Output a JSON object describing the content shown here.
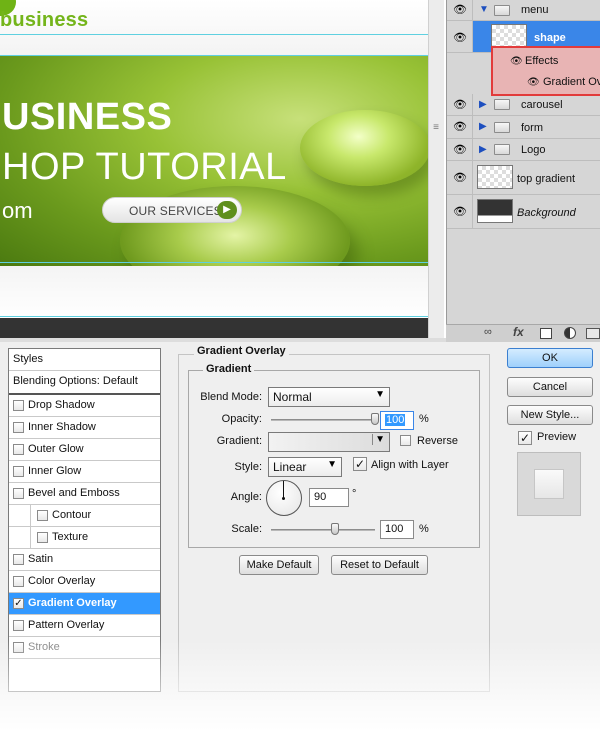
{
  "canvas": {
    "logo_text": "business",
    "hero_title": "USINESS",
    "hero_subtitle": "HOP TUTORIAL",
    "hero_url": "om",
    "cta_label": "OUR SERVICES",
    "cta_icon": "play-arrow-icon"
  },
  "layers": {
    "rows": [
      {
        "name": "menu",
        "type": "group",
        "expanded": true
      },
      {
        "name": "shape",
        "type": "layer",
        "selected": true
      },
      {
        "name": "Effects",
        "type": "effects"
      },
      {
        "name": "Gradient Ov",
        "type": "effect"
      },
      {
        "name": "carousel",
        "type": "group"
      },
      {
        "name": "form",
        "type": "group"
      },
      {
        "name": "Logo",
        "type": "group"
      },
      {
        "name": "top gradient",
        "type": "layer"
      },
      {
        "name": "Background",
        "type": "layer"
      }
    ],
    "toolbar_icons": [
      "link-icon",
      "fx-icon",
      "mask-icon",
      "adjustment-icon",
      "folder-icon"
    ],
    "fx_label": "fx",
    "highlight_color": "#e23b3b",
    "selection_color": "#3a86e8"
  },
  "dialog": {
    "styles_header": "Styles",
    "blending_options": "Blending Options: Default",
    "style_items": [
      {
        "label": "Drop Shadow",
        "checked": false
      },
      {
        "label": "Inner Shadow",
        "checked": false
      },
      {
        "label": "Outer Glow",
        "checked": false
      },
      {
        "label": "Inner Glow",
        "checked": false
      },
      {
        "label": "Bevel and Emboss",
        "checked": false
      },
      {
        "label": "Contour",
        "checked": false
      },
      {
        "label": "Texture",
        "checked": false
      },
      {
        "label": "Satin",
        "checked": false
      },
      {
        "label": "Color Overlay",
        "checked": false
      },
      {
        "label": "Gradient Overlay",
        "checked": true,
        "active": true
      },
      {
        "label": "Pattern Overlay",
        "checked": false
      },
      {
        "label": "Stroke",
        "checked": false
      }
    ],
    "panel_title": "Gradient Overlay",
    "section_title": "Gradient",
    "blend_mode_label": "Blend Mode:",
    "blend_mode_value": "Normal",
    "opacity_label": "Opacity:",
    "opacity_value": "100",
    "percent": "%",
    "gradient_label": "Gradient:",
    "reverse_label": "Reverse",
    "style_label": "Style:",
    "style_value": "Linear",
    "align_label": "Align with Layer",
    "angle_label": "Angle:",
    "angle_value": "90",
    "degree": "°",
    "scale_label": "Scale:",
    "scale_value": "100",
    "make_default": "Make Default",
    "reset_default": "Reset to Default",
    "ok": "OK",
    "cancel": "Cancel",
    "new_style": "New Style...",
    "preview": "Preview",
    "opacity_level": 1.0,
    "scale_level": 0.62
  }
}
